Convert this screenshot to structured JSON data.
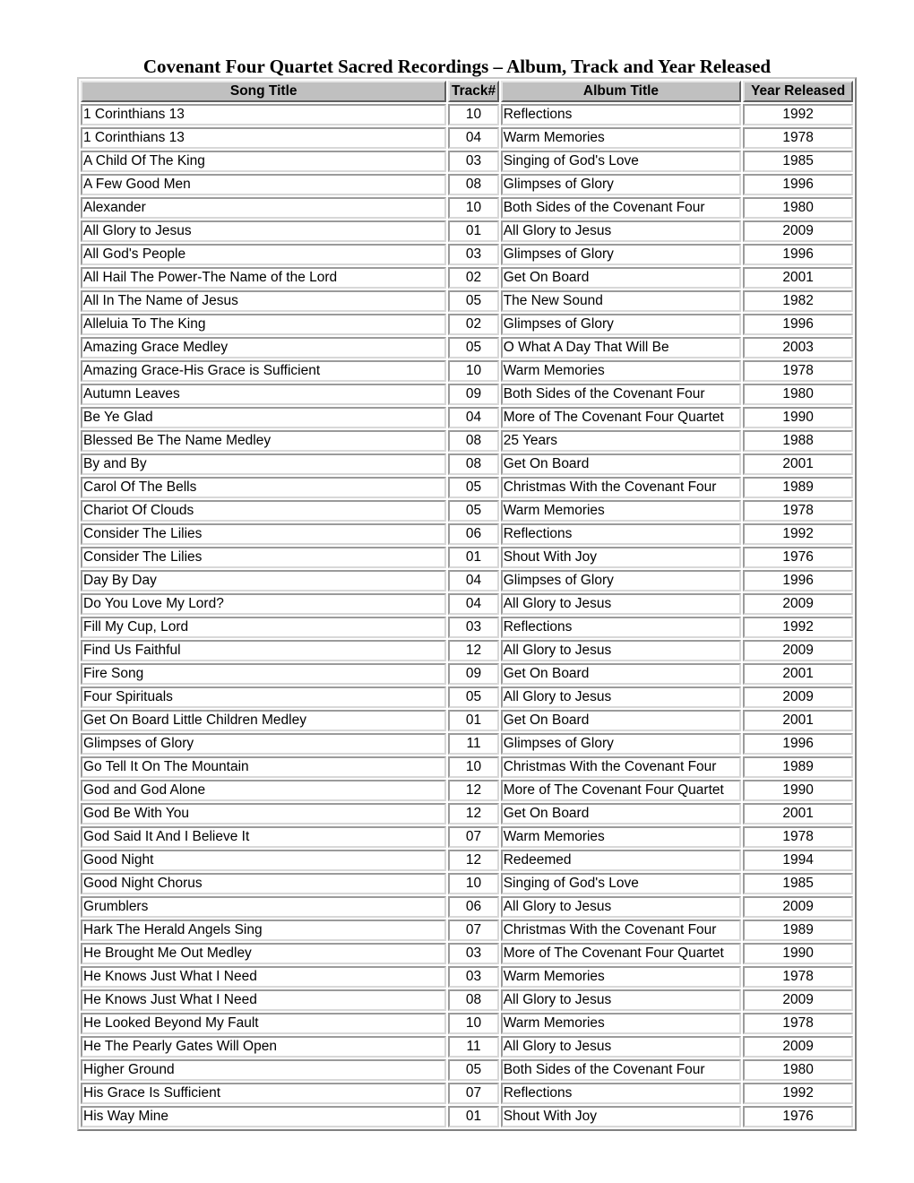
{
  "document": {
    "title": "Covenant Four Quartet Sacred Recordings – Album, Track and Year Released"
  },
  "table": {
    "headers": {
      "song_title": "Song Title",
      "track": "Track#",
      "album_title": "Album Title",
      "year": "Year Released"
    },
    "rows": [
      {
        "song": "1 Corinthians 13",
        "track": "10",
        "album": "Reflections",
        "year": "1992"
      },
      {
        "song": "1 Corinthians 13",
        "track": "04",
        "album": "Warm Memories",
        "year": "1978"
      },
      {
        "song": "A Child Of The King",
        "track": "03",
        "album": "Singing of God's Love",
        "year": "1985"
      },
      {
        "song": "A Few Good Men",
        "track": "08",
        "album": "Glimpses of Glory",
        "year": "1996"
      },
      {
        "song": "Alexander",
        "track": "10",
        "album": "Both Sides of the Covenant Four",
        "year": "1980"
      },
      {
        "song": "All Glory to Jesus",
        "track": "01",
        "album": "All Glory to Jesus",
        "year": "2009"
      },
      {
        "song": "All God's People",
        "track": "03",
        "album": "Glimpses of Glory",
        "year": "1996"
      },
      {
        "song": "All Hail The Power-The Name of the Lord",
        "track": "02",
        "album": "Get On Board",
        "year": "2001"
      },
      {
        "song": "All In The Name of Jesus",
        "track": "05",
        "album": "The New Sound",
        "year": "1982"
      },
      {
        "song": "Alleluia To The King",
        "track": "02",
        "album": "Glimpses of Glory",
        "year": "1996"
      },
      {
        "song": "Amazing Grace Medley",
        "track": "05",
        "album": "O What A Day That Will Be",
        "year": "2003"
      },
      {
        "song": "Amazing Grace-His Grace is Sufficient",
        "track": "10",
        "album": "Warm Memories",
        "year": "1978"
      },
      {
        "song": "Autumn Leaves",
        "track": "09",
        "album": "Both Sides of the Covenant Four",
        "year": "1980"
      },
      {
        "song": "Be Ye Glad",
        "track": "04",
        "album": "More of The Covenant Four Quartet",
        "year": "1990"
      },
      {
        "song": "Blessed Be The Name Medley",
        "track": "08",
        "album": "25 Years",
        "year": "1988"
      },
      {
        "song": "By and By",
        "track": "08",
        "album": "Get On Board",
        "year": "2001"
      },
      {
        "song": "Carol Of The Bells",
        "track": "05",
        "album": "Christmas With the Covenant Four",
        "year": "1989"
      },
      {
        "song": "Chariot Of Clouds",
        "track": "05",
        "album": "Warm Memories",
        "year": "1978"
      },
      {
        "song": "Consider The Lilies",
        "track": "06",
        "album": "Reflections",
        "year": "1992"
      },
      {
        "song": "Consider The Lilies",
        "track": "01",
        "album": "Shout With Joy",
        "year": "1976"
      },
      {
        "song": "Day By Day",
        "track": "04",
        "album": "Glimpses of Glory",
        "year": "1996"
      },
      {
        "song": "Do You Love My Lord?",
        "track": "04",
        "album": "All Glory to Jesus",
        "year": "2009"
      },
      {
        "song": "Fill My Cup, Lord",
        "track": "03",
        "album": "Reflections",
        "year": "1992"
      },
      {
        "song": "Find Us Faithful",
        "track": "12",
        "album": "All Glory to Jesus",
        "year": "2009"
      },
      {
        "song": "Fire Song",
        "track": "09",
        "album": "Get On Board",
        "year": "2001"
      },
      {
        "song": "Four Spirituals",
        "track": "05",
        "album": "All Glory to Jesus",
        "year": "2009"
      },
      {
        "song": "Get On Board Little Children Medley",
        "track": "01",
        "album": "Get On Board",
        "year": "2001"
      },
      {
        "song": "Glimpses of Glory",
        "track": "11",
        "album": "Glimpses of Glory",
        "year": "1996"
      },
      {
        "song": "Go Tell It On The Mountain",
        "track": "10",
        "album": "Christmas With the Covenant Four",
        "year": "1989"
      },
      {
        "song": "God and God Alone",
        "track": "12",
        "album": "More of The Covenant Four Quartet",
        "year": "1990"
      },
      {
        "song": "God Be With You",
        "track": "12",
        "album": "Get On Board",
        "year": "2001"
      },
      {
        "song": "God Said It And I Believe It",
        "track": "07",
        "album": "Warm Memories",
        "year": "1978"
      },
      {
        "song": "Good Night",
        "track": "12",
        "album": "Redeemed",
        "year": "1994"
      },
      {
        "song": "Good Night Chorus",
        "track": "10",
        "album": "Singing of God's Love",
        "year": "1985"
      },
      {
        "song": "Grumblers",
        "track": "06",
        "album": "All Glory to Jesus",
        "year": "2009"
      },
      {
        "song": "Hark The Herald Angels Sing",
        "track": "07",
        "album": "Christmas With the Covenant Four",
        "year": "1989"
      },
      {
        "song": "He Brought Me Out Medley",
        "track": "03",
        "album": "More of The Covenant Four Quartet",
        "year": "1990"
      },
      {
        "song": "He Knows Just What I Need",
        "track": "03",
        "album": "Warm Memories",
        "year": "1978"
      },
      {
        "song": "He Knows Just What I Need",
        "track": "08",
        "album": "All Glory to Jesus",
        "year": "2009"
      },
      {
        "song": "He Looked Beyond My Fault",
        "track": "10",
        "album": "Warm Memories",
        "year": "1978"
      },
      {
        "song": "He The Pearly Gates Will Open",
        "track": "11",
        "album": "All Glory to Jesus",
        "year": "2009"
      },
      {
        "song": "Higher Ground",
        "track": "05",
        "album": "Both Sides of the Covenant Four",
        "year": "1980"
      },
      {
        "song": "His Grace Is Sufficient",
        "track": "07",
        "album": "Reflections",
        "year": "1992"
      },
      {
        "song": "His Way Mine",
        "track": "01",
        "album": "Shout With Joy",
        "year": "1976"
      }
    ]
  }
}
